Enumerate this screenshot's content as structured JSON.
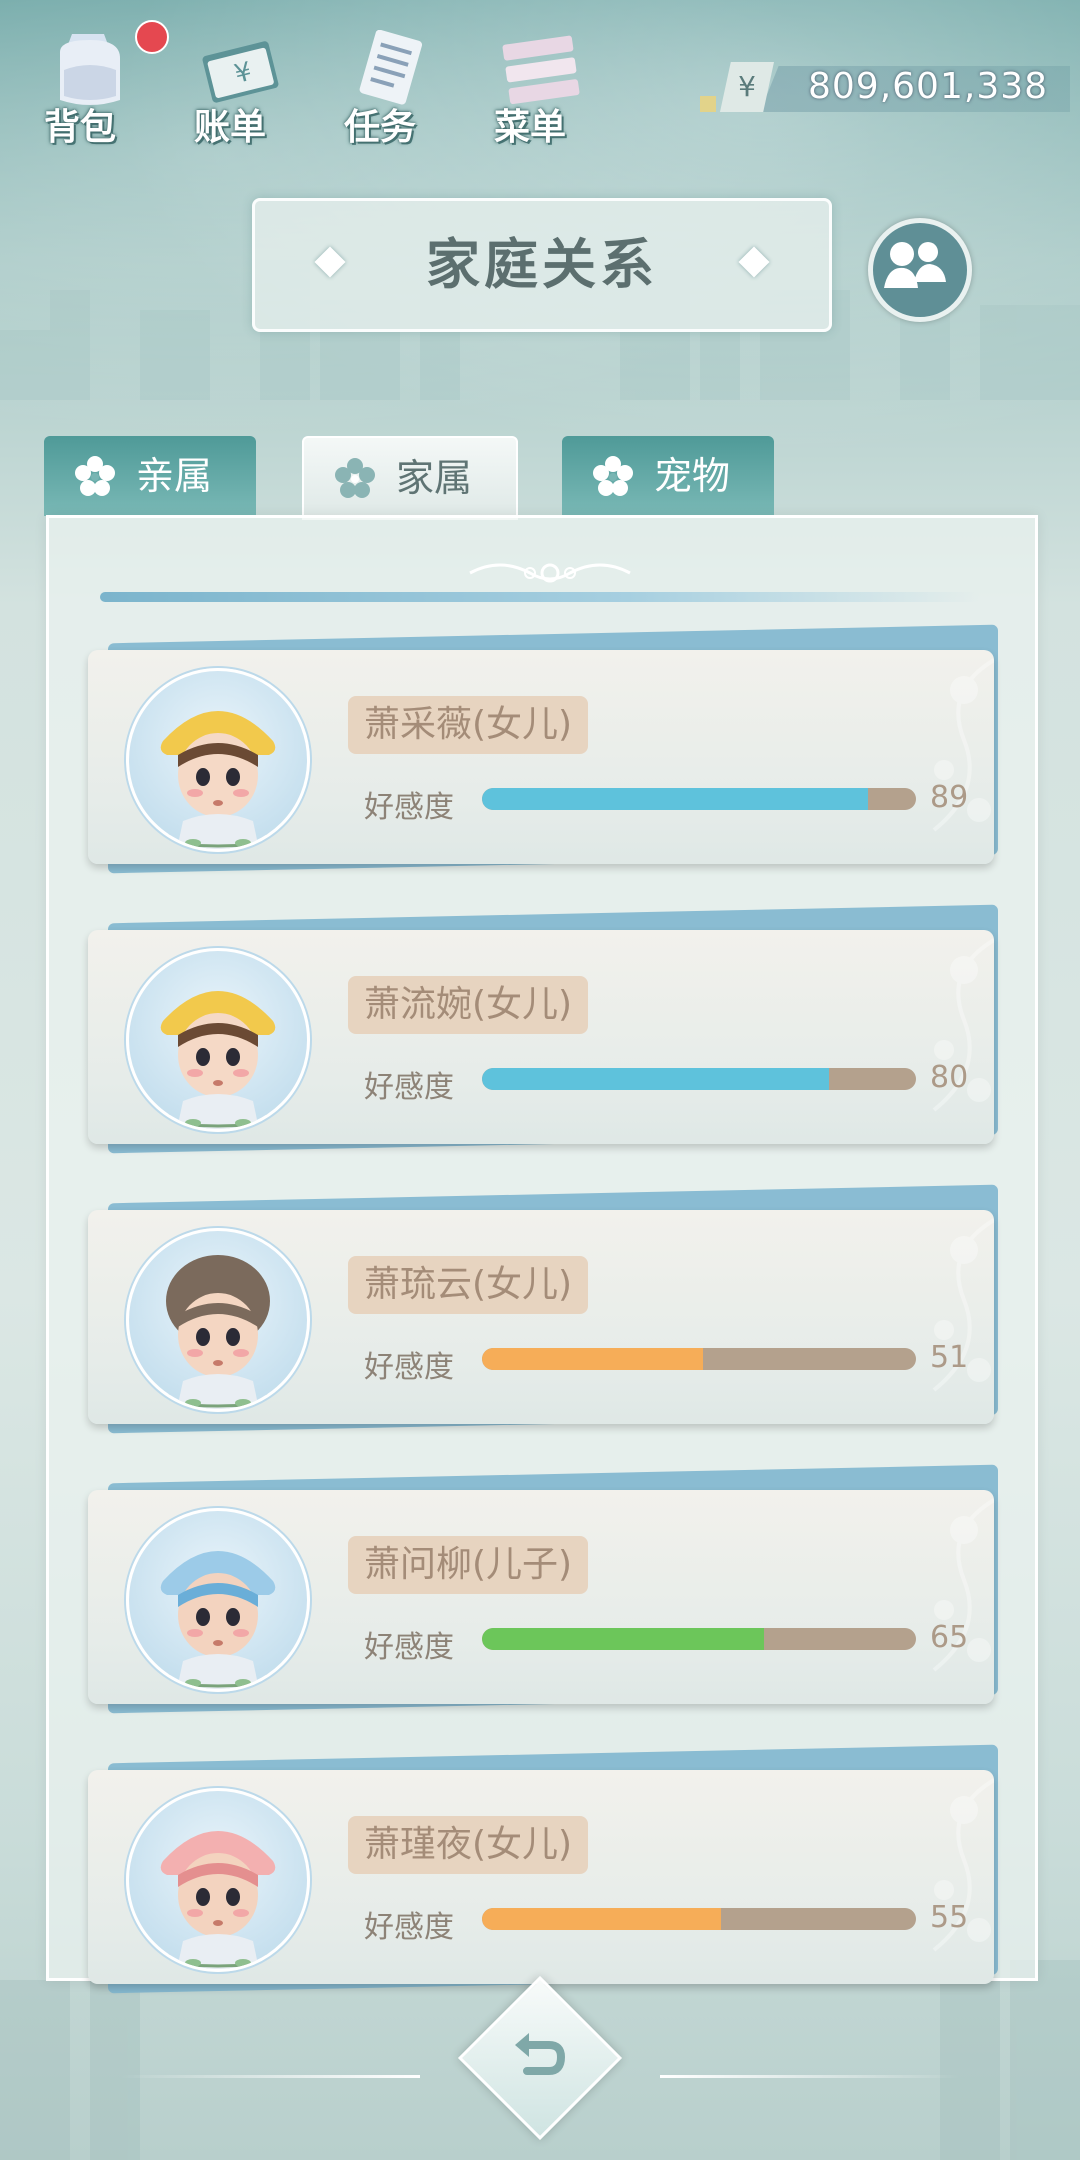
{
  "toolbar": {
    "items": [
      {
        "label": "背包",
        "icon": "backpack-icon",
        "notification": true
      },
      {
        "label": "账单",
        "icon": "bill-icon"
      },
      {
        "label": "任务",
        "icon": "task-list-icon"
      },
      {
        "label": "菜单",
        "icon": "menu-icon"
      }
    ]
  },
  "currency": {
    "symbol": "¥",
    "amount": "809,601,338"
  },
  "header": {
    "title": "家庭关系",
    "action_icon": "family-icon"
  },
  "tabs": [
    {
      "label": "亲属",
      "active": false
    },
    {
      "label": "家属",
      "active": true
    },
    {
      "label": "宠物",
      "active": false
    }
  ],
  "members": [
    {
      "name": "萧采薇(女儿)",
      "affinity_label": "好感度",
      "affinity": 89,
      "bar_color": "#5ec2dc"
    },
    {
      "name": "萧流婉(女儿)",
      "affinity_label": "好感度",
      "affinity": 80,
      "bar_color": "#5ec2dc"
    },
    {
      "name": "萧琉云(女儿)",
      "affinity_label": "好感度",
      "affinity": 51,
      "bar_color": "#f6ad58"
    },
    {
      "name": "萧问柳(儿子)",
      "affinity_label": "好感度",
      "affinity": 65,
      "bar_color": "#6cc65a"
    },
    {
      "name": "萧瑾夜(女儿)",
      "affinity_label": "好感度",
      "affinity": 55,
      "bar_color": "#f6ad58"
    }
  ],
  "footer": {
    "back_icon": "back-arrow-icon"
  }
}
